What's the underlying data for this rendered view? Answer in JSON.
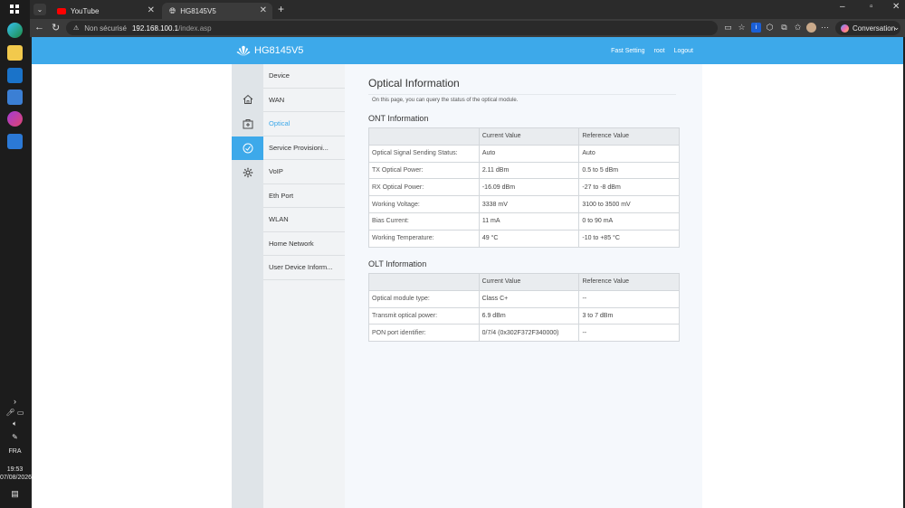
{
  "taskbar": {
    "tray": {
      "lang": "FRA",
      "time": "19:53",
      "date": "07/08/2026"
    }
  },
  "browser": {
    "tabs": [
      {
        "label": "YouTube",
        "active": false
      },
      {
        "label": "HG8145V5",
        "active": true
      }
    ],
    "url": {
      "security": "Non sécurisé",
      "host": "192.168.100.1",
      "path": "/index.asp"
    },
    "copilot_label": "Conversation"
  },
  "router": {
    "brand": "HG8145V5",
    "header_links": [
      "Fast Setting",
      "root",
      "Logout"
    ],
    "submenu": [
      "Device",
      "WAN",
      "Optical",
      "Service Provisioni...",
      "VoIP",
      "Eth Port",
      "WLAN",
      "Home Network",
      "User Device Inform..."
    ],
    "active_submenu_index": 2,
    "icons": [
      "home-icon",
      "medical-kit-icon",
      "gauge-icon",
      "gear-icon"
    ],
    "page_title": "Optical Information",
    "page_desc": "On this page, you can query the status of the optical module.",
    "ont": {
      "title": "ONT Information",
      "headers": [
        "",
        "Current Value",
        "Reference Value"
      ],
      "rows": [
        [
          "Optical Signal Sending Status:",
          "Auto",
          "Auto"
        ],
        [
          "TX Optical Power:",
          "2.11 dBm",
          "0.5 to 5 dBm"
        ],
        [
          "RX Optical Power:",
          "-16.09 dBm",
          "-27 to -8 dBm"
        ],
        [
          "Working Voltage:",
          "3338 mV",
          "3100 to 3500 mV"
        ],
        [
          "Bias Current:",
          "11 mA",
          "0 to 90 mA"
        ],
        [
          "Working Temperature:",
          "49 °C",
          "-10 to +85 °C"
        ]
      ]
    },
    "olt": {
      "title": "OLT Information",
      "headers": [
        "",
        "Current Value",
        "Reference Value"
      ],
      "rows": [
        [
          "Optical module type:",
          "Class C+",
          "--"
        ],
        [
          "Transmit optical power:",
          "6.9 dBm",
          "3 to 7 dBm"
        ],
        [
          "PON port identifier:",
          "0/7/4 (0x302F372F340000)",
          "--"
        ]
      ]
    }
  },
  "colors": {
    "accent": "#3da9ea",
    "taskbar": "#1c1c1c",
    "chrome": "#3b3b3b"
  }
}
